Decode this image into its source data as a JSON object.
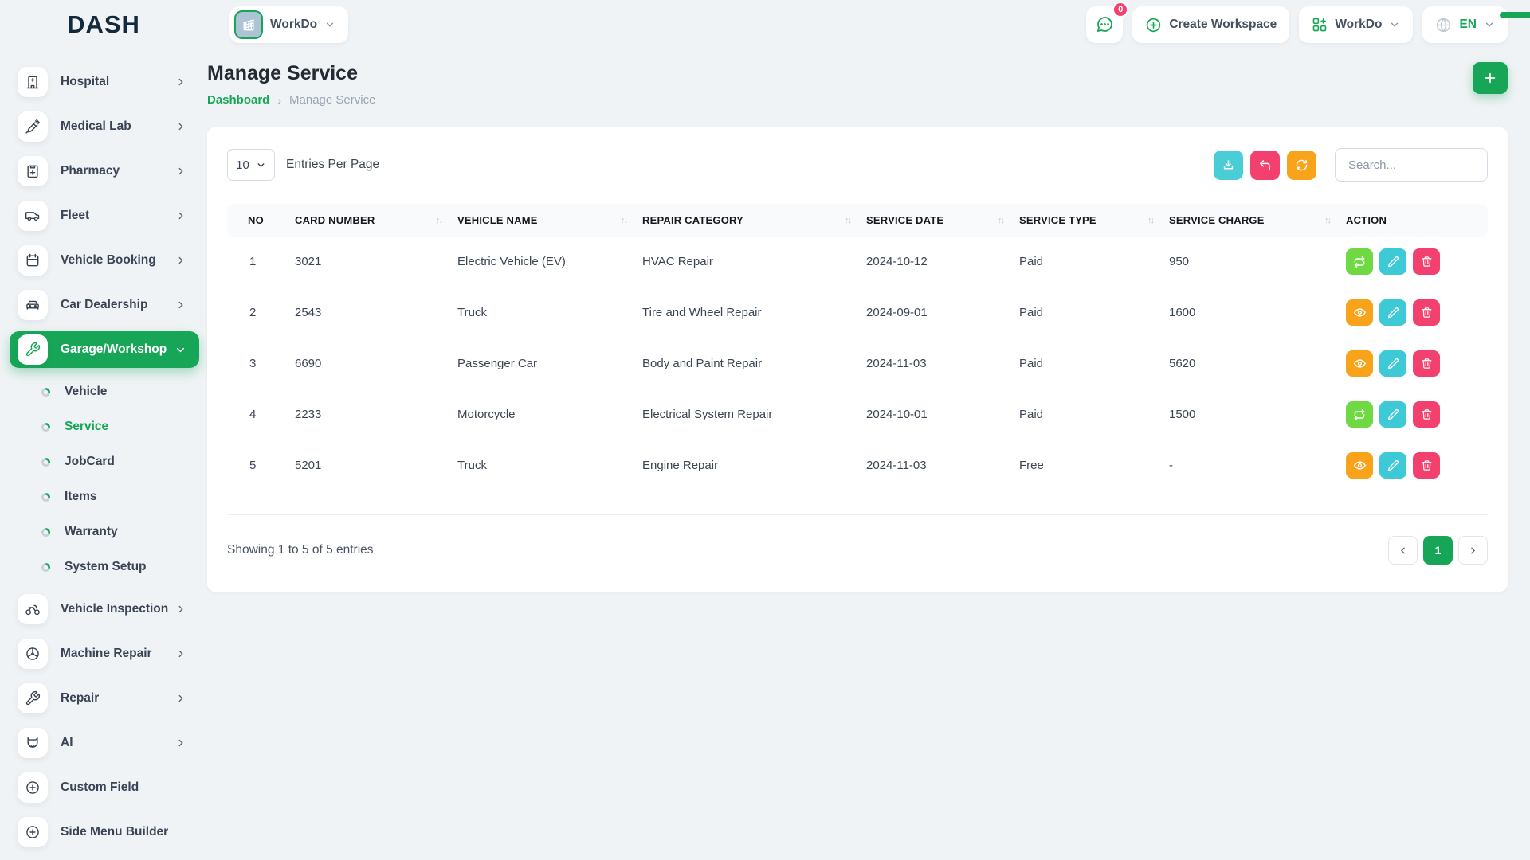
{
  "brand": {
    "logo_text": "DASH"
  },
  "topbar": {
    "workspace_pill": {
      "label": "WorkDo",
      "icon": "building-icon"
    },
    "chat": {
      "icon": "chat-bubble-icon",
      "badge_count": "0"
    },
    "create_workspace_label": "Create Workspace",
    "workdo_menu_label": "WorkDo",
    "language": {
      "icon": "globe-icon",
      "code": "EN"
    }
  },
  "sidebar": {
    "items": [
      {
        "type": "item",
        "label": "Hospital",
        "icon": "hospital-icon",
        "chevron": true
      },
      {
        "type": "item",
        "label": "Medical Lab",
        "icon": "syringe-icon",
        "chevron": true
      },
      {
        "type": "item",
        "label": "Pharmacy",
        "icon": "clipboard-plus-icon",
        "chevron": true
      },
      {
        "type": "item",
        "label": "Fleet",
        "icon": "van-icon",
        "chevron": true
      },
      {
        "type": "item",
        "label": "Vehicle Booking",
        "icon": "calendar-icon",
        "chevron": true
      },
      {
        "type": "item",
        "label": "Car Dealership",
        "icon": "car-icon",
        "chevron": true
      },
      {
        "type": "active",
        "label": "Garage/Workshop",
        "icon": "wrench-icon",
        "chevron": true
      },
      {
        "type": "sub",
        "label": "Vehicle",
        "active": false
      },
      {
        "type": "sub",
        "label": "Service",
        "active": true
      },
      {
        "type": "sub",
        "label": "JobCard",
        "active": false
      },
      {
        "type": "sub",
        "label": "Items",
        "active": false
      },
      {
        "type": "sub",
        "label": "Warranty",
        "active": false
      },
      {
        "type": "sub",
        "label": "System Setup",
        "active": false
      },
      {
        "type": "item",
        "label": "Vehicle Inspection",
        "icon": "motorcycle-icon",
        "chevron": true
      },
      {
        "type": "item",
        "label": "Machine Repair",
        "icon": "fan-icon",
        "chevron": true
      },
      {
        "type": "item",
        "label": "Repair",
        "icon": "wrench-icon",
        "chevron": true
      },
      {
        "type": "item",
        "label": "AI",
        "icon": "ai-fox-icon",
        "chevron": true
      },
      {
        "type": "item",
        "label": "Custom Field",
        "icon": "plus-circle-icon",
        "chevron": false
      },
      {
        "type": "item",
        "label": "Side Menu Builder",
        "icon": "plus-circle-icon",
        "chevron": false
      }
    ]
  },
  "page": {
    "title": "Manage Service",
    "breadcrumb": {
      "link": "Dashboard",
      "separator": "›",
      "current": "Manage Service"
    },
    "add_button_icon": "plus-icon"
  },
  "toolbar": {
    "entries_select_value": "10",
    "entries_label": "Entries Per Page",
    "buttons": [
      "download-icon",
      "undo-icon",
      "refresh-icon"
    ],
    "search_placeholder": "Search..."
  },
  "table": {
    "headers": [
      "NO",
      "CARD NUMBER",
      "VEHICLE NAME",
      "REPAIR CATEGORY",
      "SERVICE DATE",
      "SERVICE TYPE",
      "SERVICE CHARGE",
      "ACTION"
    ],
    "keys": [
      "no",
      "card_number",
      "vehicle_name",
      "repair_category",
      "service_date",
      "service_type",
      "service_charge"
    ],
    "rows": [
      {
        "no": "1",
        "card_number": "3021",
        "vehicle_name": "Electric Vehicle (EV)",
        "repair_category": "HVAC Repair",
        "service_date": "2024-10-12",
        "service_type": "Paid",
        "service_charge": "950",
        "actions": [
          "repeat",
          "edit",
          "delete"
        ]
      },
      {
        "no": "2",
        "card_number": "2543",
        "vehicle_name": "Truck",
        "repair_category": "Tire and Wheel Repair",
        "service_date": "2024-09-01",
        "service_type": "Paid",
        "service_charge": "1600",
        "actions": [
          "view",
          "edit",
          "delete"
        ]
      },
      {
        "no": "3",
        "card_number": "6690",
        "vehicle_name": "Passenger Car",
        "repair_category": "Body and Paint Repair",
        "service_date": "2024-11-03",
        "service_type": "Paid",
        "service_charge": "5620",
        "actions": [
          "view",
          "edit",
          "delete"
        ]
      },
      {
        "no": "4",
        "card_number": "2233",
        "vehicle_name": "Motorcycle",
        "repair_category": "Electrical System Repair",
        "service_date": "2024-10-01",
        "service_type": "Paid",
        "service_charge": "1500",
        "actions": [
          "repeat",
          "edit",
          "delete"
        ]
      },
      {
        "no": "5",
        "card_number": "5201",
        "vehicle_name": "Truck",
        "repair_category": "Engine Repair",
        "service_date": "2024-11-03",
        "service_type": "Free",
        "service_charge": "-",
        "actions": [
          "view",
          "edit",
          "delete"
        ]
      }
    ]
  },
  "footer": {
    "showing_text": "Showing 1 to 5 of 5 entries",
    "pagination": {
      "prev_icon": "chevron-left-icon",
      "current_page": "1",
      "next_icon": "chevron-right-icon"
    }
  },
  "colors": {
    "primary_green": "#17a658",
    "lime_action": "#6fd943",
    "teal_action": "#3ec9d6",
    "pink_action": "#f2416e",
    "orange_action": "#f9a31a",
    "teal_download": "#49cdd7",
    "page_background": "#f0f3f5"
  }
}
